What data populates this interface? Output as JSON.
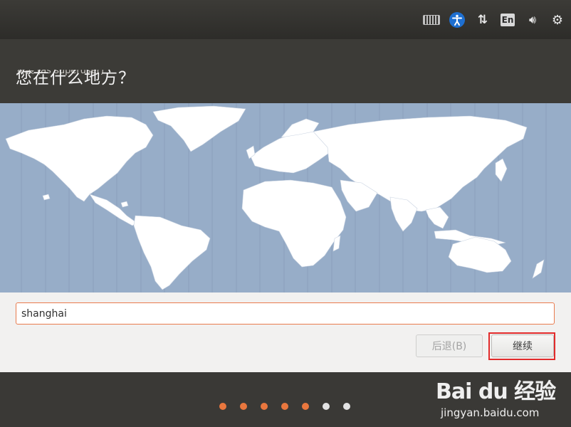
{
  "window": {
    "title": "安装 (as superuser)"
  },
  "indicators": [
    "keyboard-icon",
    "accessibility-icon",
    "network-icon",
    "language-icon",
    "volume-icon",
    "settings-icon"
  ],
  "panel_language": "En",
  "page": {
    "question": "您在什么地方？"
  },
  "location": {
    "value": "shanghai"
  },
  "buttons": {
    "back": "后退(B)",
    "continue": "继续"
  },
  "progress": {
    "total": 7,
    "completed": 5,
    "colors": {
      "done": "#e9773e",
      "todo": "#e3e3e3"
    }
  },
  "watermark": {
    "logo": "Bai du 经验",
    "url": "jingyan.baidu.com"
  },
  "colors": {
    "ocean": "#97adc8",
    "land": "#ffffff",
    "accent": "#e97b4e",
    "highlight_box": "#e22b2b"
  }
}
